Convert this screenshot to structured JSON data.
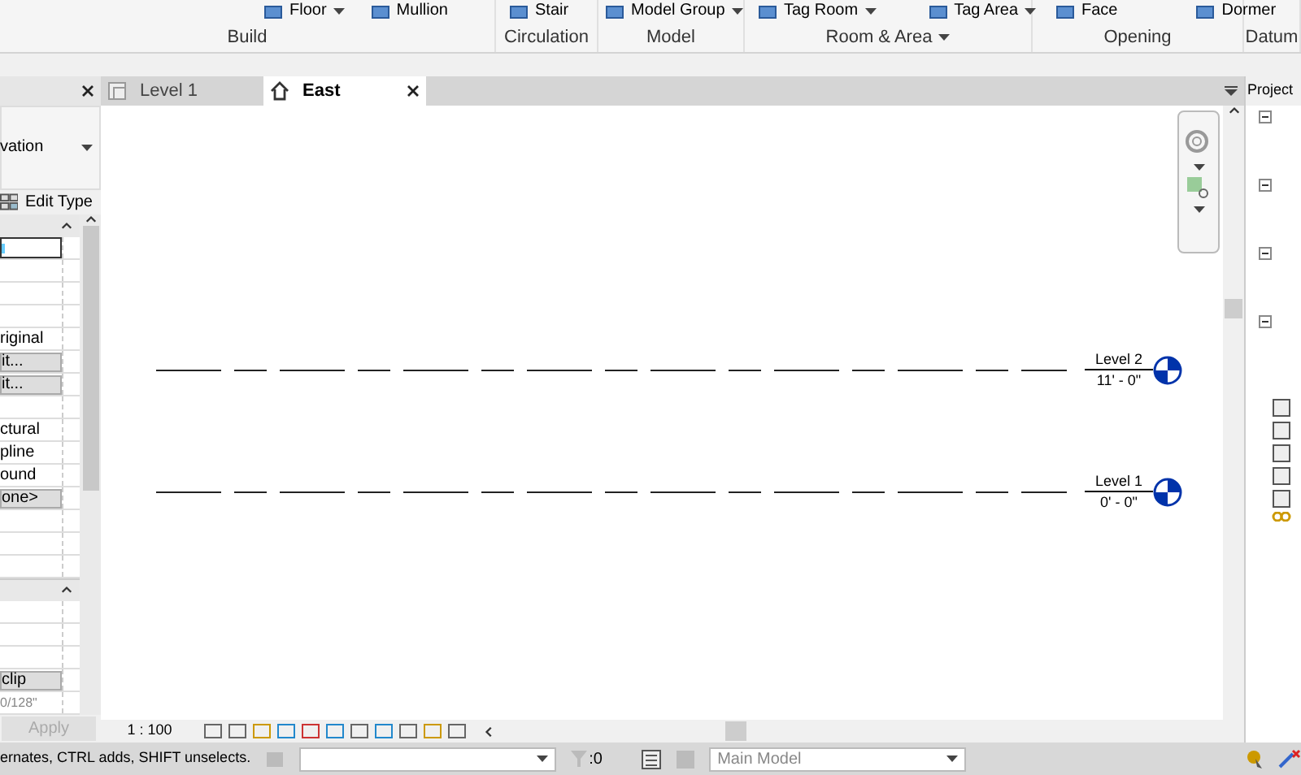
{
  "ribbon": {
    "panels": [
      {
        "label": "Build",
        "tools": [
          {
            "label": "Floor",
            "dropdown": true
          },
          {
            "label": "Mullion",
            "dropdown": false
          }
        ]
      },
      {
        "label": "Circulation",
        "tools": [
          {
            "label": "Stair",
            "dropdown": false
          }
        ]
      },
      {
        "label": "Model",
        "tools": [
          {
            "label": "Model Group",
            "dropdown": true
          }
        ]
      },
      {
        "label": "Room & Area",
        "dropdown": true,
        "tools": [
          {
            "label": "Tag Room",
            "dropdown": true
          },
          {
            "label": "Tag Area",
            "dropdown": true
          }
        ]
      },
      {
        "label": "Opening",
        "tools": [
          {
            "label": "Face",
            "dropdown": false
          },
          {
            "label": "Dormer",
            "dropdown": false
          }
        ]
      },
      {
        "label": "Datum"
      }
    ]
  },
  "view_tabs": [
    {
      "label": "Level 1",
      "selected": false,
      "kind": "plan"
    },
    {
      "label": "East",
      "selected": true,
      "kind": "elevation"
    }
  ],
  "properties": {
    "type_name": "vation",
    "edit_type": "Edit Type",
    "rows": [
      {
        "kind": "active",
        "value": ""
      },
      {
        "kind": "text",
        "value": ""
      },
      {
        "kind": "text",
        "value": ""
      },
      {
        "kind": "text",
        "value": ""
      },
      {
        "kind": "text",
        "value": "riginal"
      },
      {
        "kind": "button",
        "value": "it..."
      },
      {
        "kind": "button",
        "value": "it..."
      },
      {
        "kind": "text",
        "value": ""
      },
      {
        "kind": "text",
        "value": "ctural"
      },
      {
        "kind": "text",
        "value": "pline"
      },
      {
        "kind": "text",
        "value": "ound"
      },
      {
        "kind": "button",
        "value": "one>"
      },
      {
        "kind": "text",
        "value": ""
      },
      {
        "kind": "text",
        "value": ""
      },
      {
        "kind": "text",
        "value": ""
      },
      {
        "kind": "header",
        "value": ""
      },
      {
        "kind": "text",
        "value": ""
      },
      {
        "kind": "text",
        "value": ""
      },
      {
        "kind": "text",
        "value": ""
      },
      {
        "kind": "button",
        "value": "clip"
      },
      {
        "kind": "faint",
        "value": "0/128\""
      }
    ],
    "apply": {
      "label": "Apply",
      "disabled": true
    }
  },
  "levels": [
    {
      "name": "Level 2",
      "elevation": "11' - 0\""
    },
    {
      "name": "Level 1",
      "elevation": "0' - 0\""
    }
  ],
  "view_control_bar": {
    "scale": "1 : 100"
  },
  "project_browser": {
    "title": "Project"
  },
  "status_bar": {
    "message": "ernates, CTRL adds, SHIFT unselects.",
    "count": ":0",
    "model": "Main Model"
  }
}
